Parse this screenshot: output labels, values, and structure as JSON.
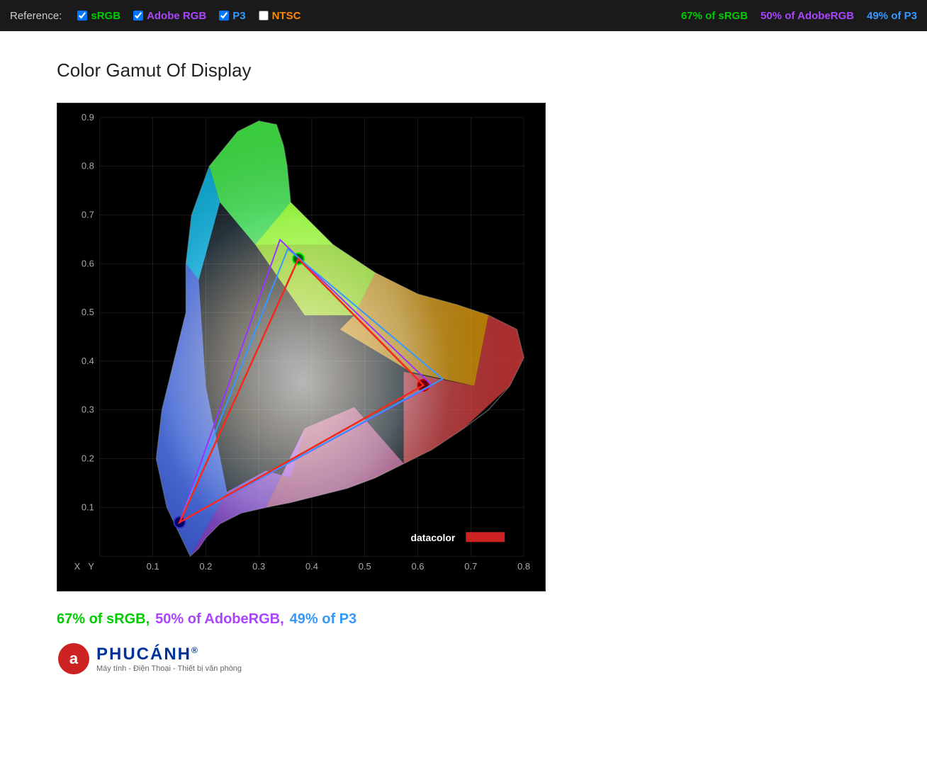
{
  "topbar": {
    "reference_label": "Reference:",
    "checkboxes": [
      {
        "id": "cb-srgb",
        "label": "sRGB",
        "checked": true,
        "color_class": "cb-srgb"
      },
      {
        "id": "cb-adobe",
        "label": "Adobe RGB",
        "checked": true,
        "color_class": "cb-adobe"
      },
      {
        "id": "cb-p3",
        "label": "P3",
        "checked": true,
        "color_class": "cb-p3"
      },
      {
        "id": "cb-ntsc",
        "label": "NTSC",
        "checked": false,
        "color_class": "cb-ntsc"
      }
    ],
    "stat_srgb": "67% of sRGB",
    "stat_adobe": "50% of AdobeRGB",
    "stat_p3": "49% of P3"
  },
  "main": {
    "title": "Color Gamut Of Display",
    "chart": {
      "y_labels": [
        "0.9",
        "0.8",
        "0.7",
        "0.6",
        "0.5",
        "0.4",
        "0.3",
        "0.2",
        "0.1",
        "Y"
      ],
      "x_labels": [
        "X",
        "0.1",
        "0.2",
        "0.3",
        "0.4",
        "0.5",
        "0.6",
        "0.7",
        "0.8"
      ],
      "watermark": "datacolor"
    },
    "bottom_stats": "67% of sRGB, 50% of AdobeRGB, 49% of P3"
  },
  "logo": {
    "symbol": "a",
    "name": "PHUCÁNH",
    "tagline": "Máy tính - Điện Thoại - Thiết bị văn phòng",
    "registered": "®"
  }
}
